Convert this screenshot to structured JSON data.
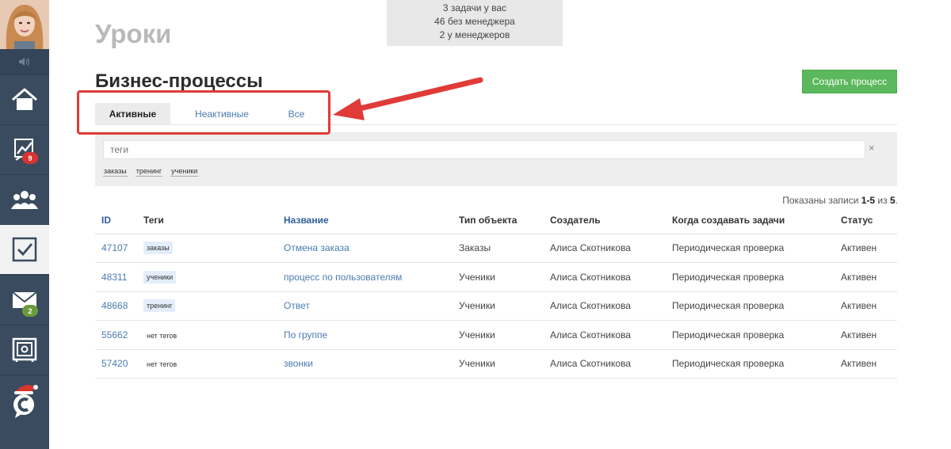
{
  "notification": {
    "line1": "3 задачи у вас",
    "line2": "46 без менеджера",
    "line3": "2 у менеджеров"
  },
  "sidebar": {
    "items": [
      {
        "icon": "home-icon",
        "badge": ""
      },
      {
        "icon": "stats-chart-icon",
        "badge": "9"
      },
      {
        "icon": "users-icon",
        "badge": ""
      },
      {
        "icon": "checkbox-tasks-icon",
        "badge": "",
        "active": true
      },
      {
        "icon": "mail-icon",
        "badge": "2"
      },
      {
        "icon": "safe-icon",
        "badge": ""
      },
      {
        "icon": "chat-logo-icon",
        "badge": ""
      }
    ]
  },
  "page": {
    "title": "Уроки",
    "section_title": "Бизнес-процессы",
    "create_button": "Создать процесс"
  },
  "tabs": [
    "Активные",
    "Неактивные",
    "Все"
  ],
  "filter": {
    "placeholder": "теги",
    "clear": "×",
    "tags": [
      "заказы",
      "тренинг",
      "ученики"
    ]
  },
  "records": {
    "prefix": "Показаны записи ",
    "range": "1-5",
    "middle": " из ",
    "total": "5",
    "suffix": "."
  },
  "table": {
    "headers": [
      "ID",
      "Теги",
      "Название",
      "Тип объекта",
      "Создатель",
      "Когда создавать задачи",
      "Статус"
    ],
    "rows": [
      {
        "id": "47107",
        "tag": "заказы",
        "name": "Отмена заказа",
        "type": "Заказы",
        "creator": "Алиса Скотникова",
        "when": "Периодическая проверка",
        "status": "Активен"
      },
      {
        "id": "48311",
        "tag": "ученики",
        "name": "процесс по пользователям",
        "type": "Ученики",
        "creator": "Алиса Скотникова",
        "when": "Периодическая проверка",
        "status": "Активен"
      },
      {
        "id": "48668",
        "tag": "тренинг",
        "name": "Ответ",
        "type": "Ученики",
        "creator": "Алиса Скотникова",
        "when": "Периодическая проверка",
        "status": "Активен"
      },
      {
        "id": "55662",
        "tag": "",
        "notag": "нет тегов",
        "name": "По группе",
        "type": "Ученики",
        "creator": "Алиса Скотникова",
        "when": "Периодическая проверка",
        "status": "Активен"
      },
      {
        "id": "57420",
        "tag": "",
        "notag": "нет тегов",
        "name": "звонки",
        "type": "Ученики",
        "creator": "Алиса Скотникова",
        "when": "Периодическая проверка",
        "status": "Активен"
      }
    ]
  },
  "colors": {
    "sidebar": "#3a4b5f",
    "accent_green": "#5cb85c",
    "link_blue": "#4a7cb0",
    "annotation_red": "#e03b37"
  }
}
